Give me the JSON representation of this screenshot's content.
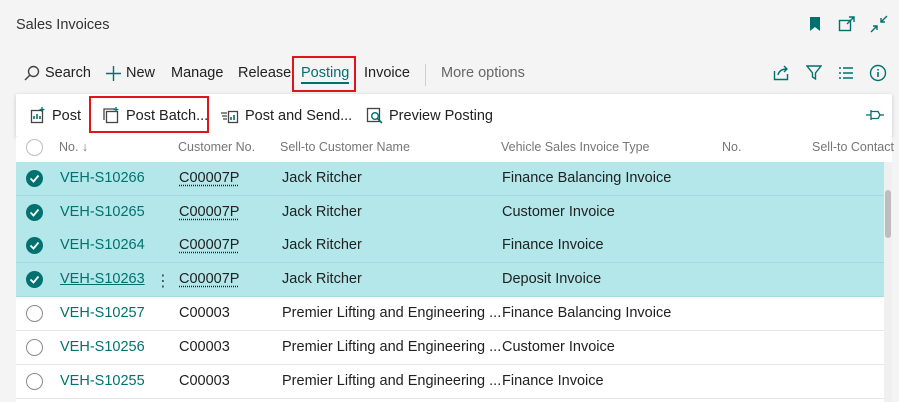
{
  "title": "Sales Invoices",
  "actions": {
    "search": "Search",
    "new": "New",
    "manage": "Manage",
    "release": "Release",
    "posting": "Posting",
    "invoice": "Invoice",
    "more": "More options"
  },
  "posting_menu": {
    "post": "Post",
    "post_batch": "Post Batch...",
    "post_and_send": "Post and Send...",
    "preview_posting": "Preview Posting"
  },
  "columns": {
    "no": "No. ↓",
    "customer_no": "Customer No.",
    "sell_to_name": "Sell-to Customer Name",
    "type": "Vehicle Sales Invoice Type",
    "no2": "No.",
    "sell_to_contact": "Sell-to Contact"
  },
  "rows": [
    {
      "no": "VEH-S10266",
      "customer_no": "C00007P",
      "name": "Jack Ritcher",
      "type": "Finance Balancing Invoice",
      "selected": true
    },
    {
      "no": "VEH-S10265",
      "customer_no": "C00007P",
      "name": "Jack Ritcher",
      "type": "Customer Invoice",
      "selected": true
    },
    {
      "no": "VEH-S10264",
      "customer_no": "C00007P",
      "name": "Jack Ritcher",
      "type": "Finance Invoice",
      "selected": true
    },
    {
      "no": "VEH-S10263",
      "customer_no": "C00007P",
      "name": "Jack Ritcher",
      "type": "Deposit Invoice",
      "selected": true
    },
    {
      "no": "VEH-S10257",
      "customer_no": "C00003",
      "name": "Premier Lifting and Engineering ...",
      "type": "Finance Balancing Invoice",
      "selected": false
    },
    {
      "no": "VEH-S10256",
      "customer_no": "C00003",
      "name": "Premier Lifting and Engineering ...",
      "type": "Customer Invoice",
      "selected": false
    },
    {
      "no": "VEH-S10255",
      "customer_no": "C00003",
      "name": "Premier Lifting and Engineering ...",
      "type": "Finance Invoice",
      "selected": false
    }
  ],
  "colors": {
    "accent": "#00716f",
    "selected_row": "#b3e7ea",
    "highlight_box": "#e0151b"
  }
}
